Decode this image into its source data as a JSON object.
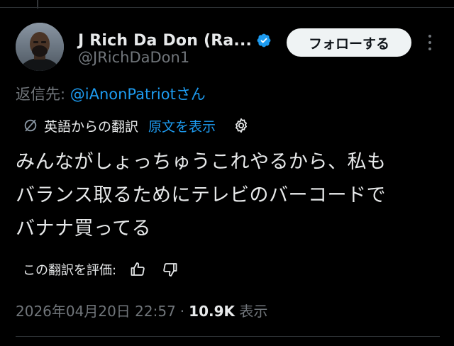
{
  "author": {
    "display_name": "J Rich Da Don (Ra...",
    "handle": "@JRichDaDon1",
    "verified": true,
    "verified_color": "#1d9bf0"
  },
  "follow_button": {
    "label": "フォローする"
  },
  "more_menu": {
    "icon": "more-vertical-icon"
  },
  "reply": {
    "prefix": "返信先: ",
    "to_handle": "@iAnonPatriot",
    "suffix": "さん"
  },
  "translation": {
    "translated_from": "英語からの翻訳",
    "show_original": "原文を表示",
    "icon": "translate-icon",
    "settings_icon": "gear-icon"
  },
  "tweet": {
    "text": "みんながしょっちゅうこれやるから、私も\nバランス取るためにテレビのバーコードで\nバナナ買ってる"
  },
  "rate_translation": {
    "label": "この翻訳を評価:",
    "like_icon": "thumbs-up-icon",
    "dislike_icon": "thumbs-down-icon"
  },
  "meta": {
    "timestamp": "2026年04月20日 22:57",
    "separator": "·",
    "views_count": "10.9K",
    "views_label": "表示"
  },
  "colors": {
    "background": "#000000",
    "text_primary": "#e7e9ea",
    "text_secondary": "#71767b",
    "accent": "#1d9bf0",
    "button_bg": "#eff3f4"
  }
}
